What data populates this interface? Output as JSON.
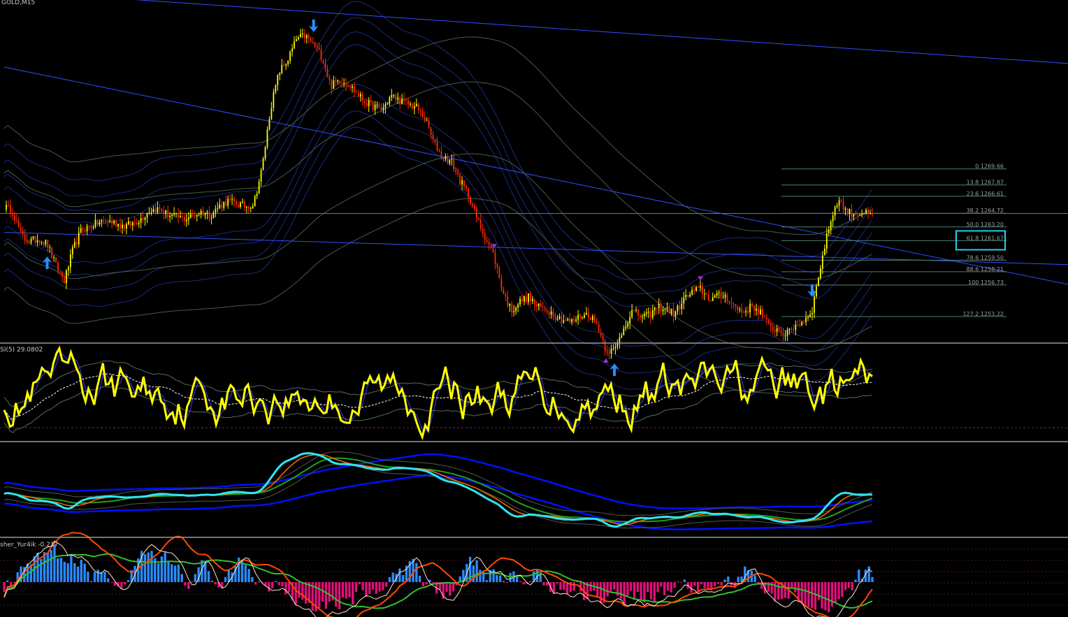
{
  "colors": {
    "background": "#000000",
    "candle_up": "#ffff00",
    "candle_down": "#ff2a00",
    "channel_line": "#3050ff",
    "band_dark": "#1a2a80",
    "band_grey": "#4a5a4a",
    "fib_level": "#4f7f6f",
    "fib_highlight": "#22d3e6",
    "signal_arrow": "#2a8cff",
    "signal_arrow_purple": "#9b30d6",
    "rsi_line": "#ffff00",
    "ma_blue": "#0010ff",
    "ma_cyan": "#2ee6f0",
    "ma_orange": "#ff6a00",
    "ma_green": "#20a020",
    "hist_up": "#2a8cff",
    "hist_down": "#e0107a",
    "osc_white": "#ffe8c8",
    "osc_orange": "#ff4a00",
    "osc_green": "#30c030"
  },
  "panes": {
    "main_title": "GOLD,M15",
    "rsi_title": "SI(5) 29.0802",
    "fisher_title": "sher_Yur4ik -0.217"
  },
  "chart_data": [
    {
      "type": "candlestick",
      "title": "GOLD,M15",
      "ylim": [
        1250.5,
        1288
      ],
      "price_series": [
        1265.5,
        1264.9,
        1262.2,
        1261.6,
        1261.9,
        1261.3,
        1258.9,
        1257.2,
        1260.7,
        1262.9,
        1263.3,
        1263.7,
        1263.9,
        1263.6,
        1263.3,
        1263.6,
        1264.2,
        1265.1,
        1265.2,
        1264.6,
        1264.3,
        1264.1,
        1264.5,
        1264.9,
        1264.5,
        1265.5,
        1266.1,
        1265.8,
        1265.5,
        1265.7,
        1269.7,
        1276.5,
        1280.5,
        1281.8,
        1284.1,
        1284.5,
        1283.5,
        1282.1,
        1278.9,
        1279.6,
        1279.2,
        1278.1,
        1277.1,
        1276.6,
        1276.3,
        1277.8,
        1277.3,
        1276.9,
        1276.5,
        1275.2,
        1272.5,
        1271.0,
        1270.5,
        1268.4,
        1266.8,
        1264.1,
        1262.0,
        1259.9,
        1256.0,
        1253.9,
        1254.9,
        1255.4,
        1254.3,
        1254.1,
        1253.4,
        1252.9,
        1252.6,
        1253.3,
        1253.5,
        1252.3,
        1249.5,
        1249.4,
        1251.8,
        1253.8,
        1253.3,
        1253.3,
        1254.3,
        1254.1,
        1253.5,
        1255.1,
        1255.9,
        1256.3,
        1255.2,
        1255.5,
        1255.5,
        1254.3,
        1253.7,
        1254.4,
        1253.7,
        1252.0,
        1251.8,
        1251.2,
        1252.2,
        1252.7,
        1254.0,
        1259.0,
        1263.4,
        1266.3,
        1264.9,
        1264.7,
        1264.8,
        1264.3
      ],
      "channel": {
        "upper": [
          [
            0,
            1289.5
          ],
          [
            100,
            1281.4
          ]
        ],
        "middle": [
          [
            0,
            1281.0
          ],
          [
            100,
            1256.8
          ]
        ],
        "lower": [
          [
            0,
            1262.6
          ],
          [
            100,
            1259.0
          ]
        ]
      },
      "fibonacci": [
        {
          "text": "0 1269.66",
          "price": 1269.66
        },
        {
          "text": "13.8 1267.87",
          "price": 1267.87
        },
        {
          "text": "23.6 1266.61",
          "price": 1266.61
        },
        {
          "text": "38.2 1264.72",
          "price": 1264.72
        },
        {
          "text": "50.0 1263.20",
          "price": 1263.2
        },
        {
          "text": "61.8 1261.67",
          "price": 1261.67
        },
        {
          "text": "78.6 1259.50",
          "price": 1259.5
        },
        {
          "text": "88.6 1258.21",
          "price": 1258.21
        },
        {
          "text": "100 1256.73",
          "price": 1256.73
        },
        {
          "text": "127.2 1253.22",
          "price": 1253.22
        }
      ],
      "highlighted_level": "61.8 1261.67",
      "arrows": [
        {
          "index": 5,
          "kind": "up"
        },
        {
          "index": 36,
          "kind": "down"
        },
        {
          "index": 71,
          "kind": "up"
        },
        {
          "index": 94,
          "kind": "down"
        }
      ]
    },
    {
      "type": "line",
      "title": "SI(5) 29.0802",
      "ylim": [
        0,
        100
      ]
    },
    {
      "type": "line",
      "title": "",
      "note_series": [
        "ma-blue",
        "ma-cyan",
        "ma-orange",
        "ma-green"
      ]
    },
    {
      "type": "bar",
      "title": "sher_Yur4ik -0.217"
    }
  ]
}
